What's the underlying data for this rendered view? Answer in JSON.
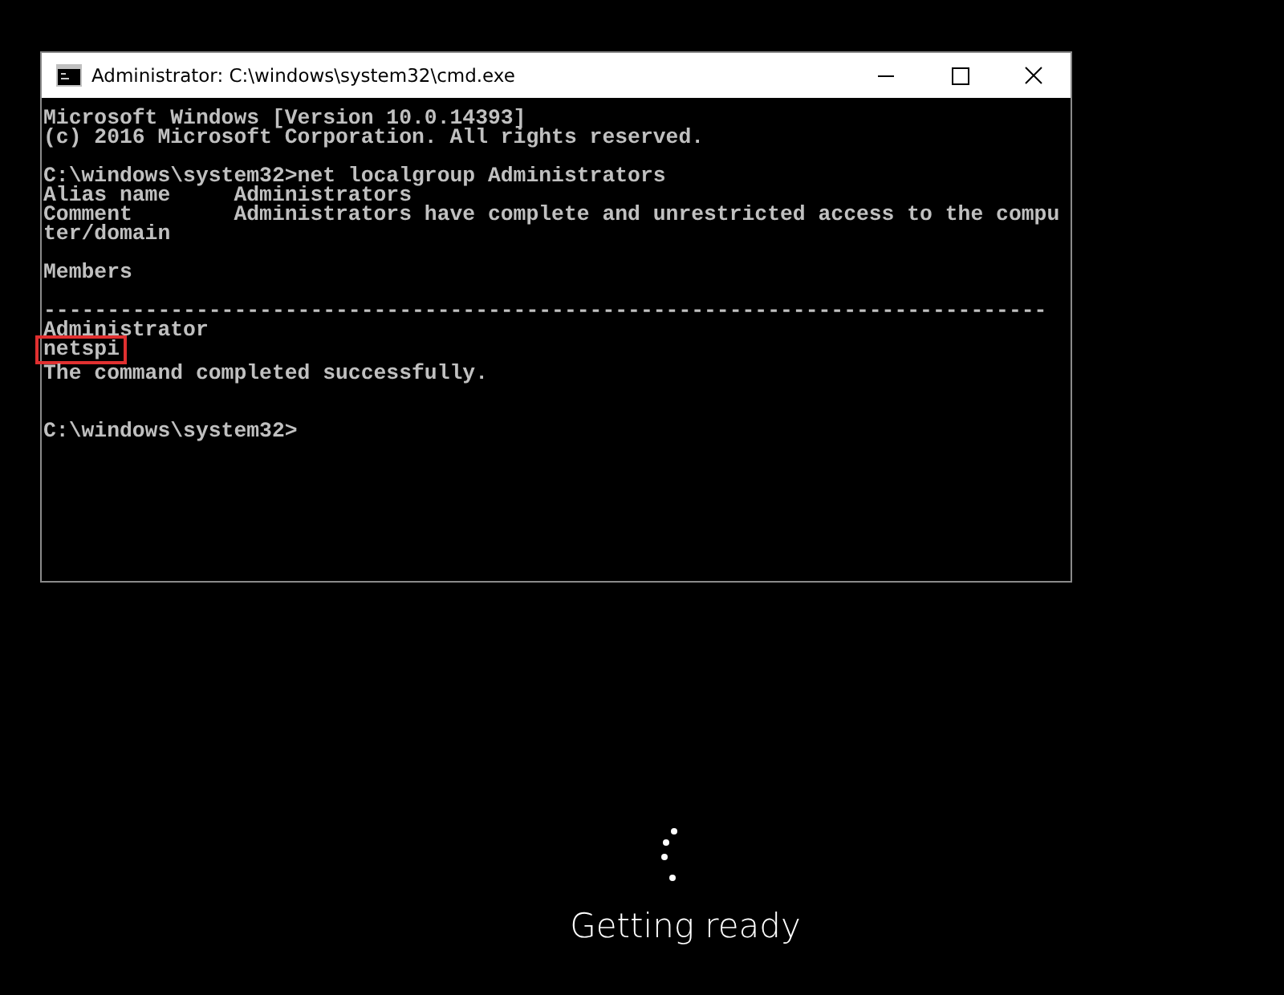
{
  "window": {
    "title": "Administrator: C:\\windows\\system32\\cmd.exe"
  },
  "console": {
    "lines": [
      {
        "kind": "text",
        "text": "Microsoft Windows [Version 10.0.14393]",
        "highlighted": false
      },
      {
        "kind": "text",
        "text": "(c) 2016 Microsoft Corporation. All rights reserved.",
        "highlighted": false
      },
      {
        "kind": "blank"
      },
      {
        "kind": "text",
        "text": "C:\\windows\\system32>net localgroup Administrators",
        "highlighted": false
      },
      {
        "kind": "text",
        "text": "Alias name     Administrators",
        "highlighted": false
      },
      {
        "kind": "text",
        "text": "Comment        Administrators have complete and unrestricted access to the compu",
        "highlighted": false
      },
      {
        "kind": "text",
        "text": "ter/domain",
        "highlighted": false
      },
      {
        "kind": "blank"
      },
      {
        "kind": "text",
        "text": "Members",
        "highlighted": false
      },
      {
        "kind": "blank"
      },
      {
        "kind": "text",
        "text": "-------------------------------------------------------------------------------",
        "highlighted": false
      },
      {
        "kind": "text",
        "text": "Administrator",
        "highlighted": false
      },
      {
        "kind": "text",
        "text": "netspi",
        "highlighted": true
      },
      {
        "kind": "text",
        "text": "The command completed successfully.",
        "highlighted": false
      },
      {
        "kind": "blank"
      },
      {
        "kind": "blank"
      },
      {
        "kind": "text",
        "text": "C:\\windows\\system32>",
        "highlighted": false
      }
    ]
  },
  "status": {
    "text": "Getting ready"
  }
}
